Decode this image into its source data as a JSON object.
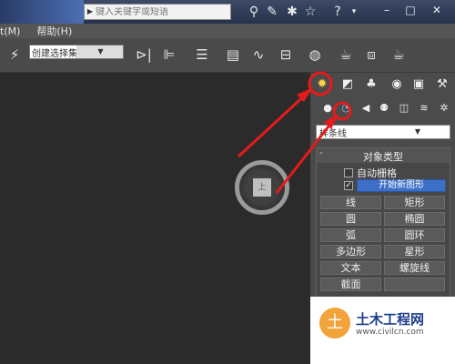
{
  "titlebar": {
    "search_placeholder": "键入关键字或短语",
    "icons": [
      "binoculars-icon",
      "wrench-icon",
      "star-tools-icon",
      "star-icon",
      "help-icon"
    ],
    "window_buttons": [
      "–",
      "□",
      "✕"
    ]
  },
  "menubar": {
    "items": [
      "t(M)",
      "帮助(H)"
    ]
  },
  "toolbar": {
    "selection_set": "创建选择集"
  },
  "viewport": {
    "viewcube_face": "上"
  },
  "command_panel": {
    "category": "样条线",
    "rollout_title": "对象类型",
    "rollout_toggle": "-",
    "autogrid_label": "自动栅格",
    "start_new_shape_label": "开始新图形",
    "start_new_shape_checked": "✓",
    "object_buttons": [
      "线",
      "矩形",
      "圆",
      "椭圆",
      "弧",
      "圆环",
      "多边形",
      "星形",
      "文本",
      "螺旋线",
      "截面",
      ""
    ]
  },
  "watermark": {
    "title": "土木工程网",
    "url": "www.civilcn.com"
  },
  "colors": {
    "annotation": "#e51b1b",
    "highlight": "#3d6fc6"
  }
}
